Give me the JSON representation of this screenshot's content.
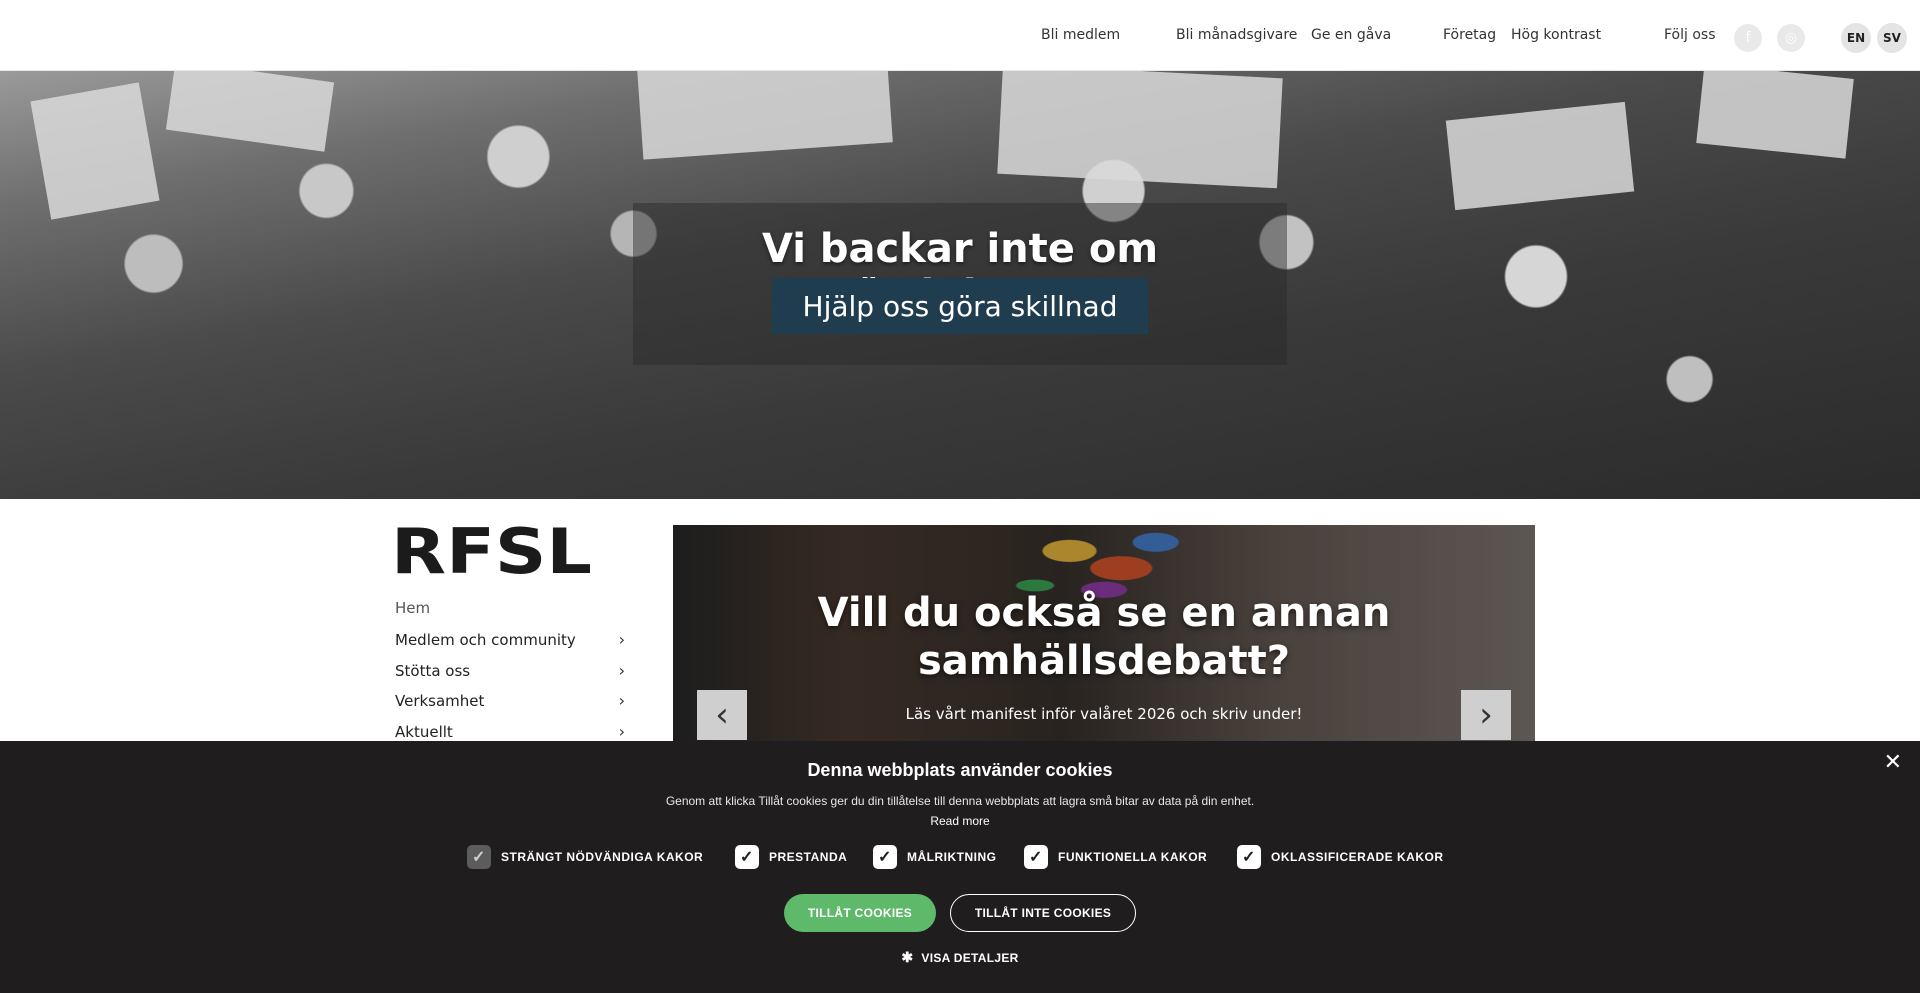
{
  "topbar": {
    "links": [
      "Bli medlem",
      "Bli månadsgivare",
      "Ge en gåva",
      "Företag",
      "Hög kontrast",
      "Följ oss"
    ],
    "social_icons": [
      "facebook-icon",
      "instagram-icon"
    ],
    "languages": [
      "EN",
      "SV"
    ]
  },
  "hero": {
    "title": "Vi backar inte om rättigheter",
    "cta": "Hjälp oss göra skillnad"
  },
  "logo": {
    "text": "RFSL"
  },
  "sidenav": {
    "items": [
      {
        "label": "Hem",
        "has_children": false
      },
      {
        "label": "Medlem och community",
        "has_children": true
      },
      {
        "label": "Stötta oss",
        "has_children": true
      },
      {
        "label": "Verksamhet",
        "has_children": true
      },
      {
        "label": "Aktuellt",
        "has_children": true
      }
    ]
  },
  "slider": {
    "title": "Vill du också se en annan samhällsdebatt?",
    "subtitle": "Läs vårt manifest inför valåret 2026 och skriv under!",
    "prev_icon": "chevron-left-icon",
    "next_icon": "chevron-right-icon"
  },
  "cookie_banner": {
    "title": "Denna webbplats använder cookies",
    "text": "Genom att klicka Tillåt cookies ger du din tillåtelse till denna webbplats att lagra små bitar av data på din enhet.",
    "read_more": "Read more",
    "options": [
      {
        "label": "STRÄNGT NÖDVÄNDIGA KAKOR",
        "checked": true,
        "disabled": true
      },
      {
        "label": "PRESTANDA",
        "checked": true,
        "disabled": false
      },
      {
        "label": "MÅLRIKTNING",
        "checked": true,
        "disabled": false
      },
      {
        "label": "FUNKTIONELLA KAKOR",
        "checked": true,
        "disabled": false
      },
      {
        "label": "OKLASSIFICERADE KAKOR",
        "checked": true,
        "disabled": false
      }
    ],
    "allow_button": "TILLÅT COOKIES",
    "deny_button": "TILLÅT INTE COOKIES",
    "details_link": "VISA DETALJER",
    "close_icon": "close-icon",
    "accent_color": "#5fb96b"
  }
}
